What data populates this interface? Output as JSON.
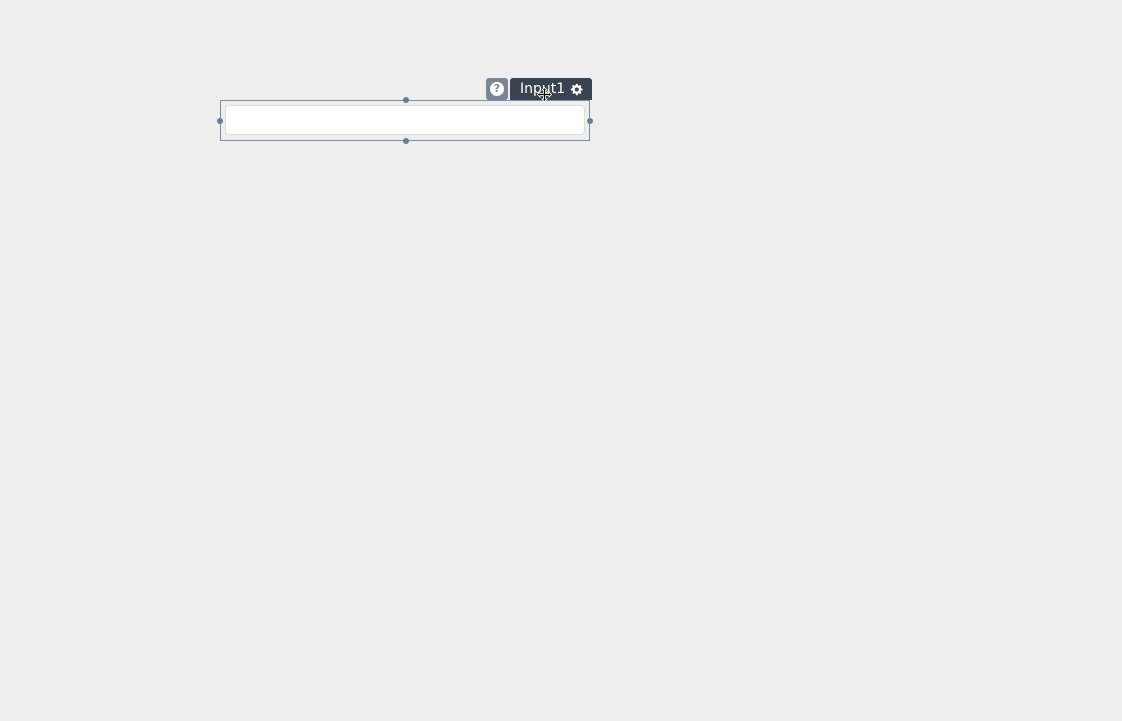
{
  "widget": {
    "name_label": "Input1",
    "help_icon": "question-circle-icon",
    "settings_icon": "gear-icon",
    "input_value": "",
    "input_placeholder": ""
  },
  "colors": {
    "canvas_bg": "#eeeeee",
    "tag_bg": "#3a444e",
    "help_bg": "#7a8694",
    "selection_border": "#7d8c9f",
    "handle": "#6c7d92"
  }
}
